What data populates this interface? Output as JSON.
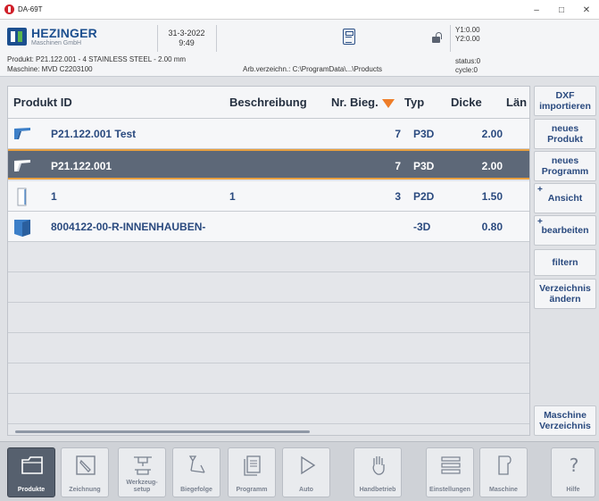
{
  "window": {
    "title": "DA-69T",
    "minimize": "–",
    "maximize": "□",
    "close": "✕"
  },
  "header": {
    "brand": "HEZINGER",
    "brand_sub": "Maschinen GmbH",
    "date": "31-3-2022",
    "time": "9:49",
    "y1": "Y1:0.00",
    "y2": "Y2:0.00",
    "product_line": "Produkt: P21.122.001 - 4 STAINLESS STEEL - 2.00 mm",
    "machine_line": "Maschine: MVD C2203100",
    "dir_line": "Arb.verzeichn.: C:\\ProgramData\\...\\Products",
    "status": "status:0",
    "cycle": "cycle:0"
  },
  "table": {
    "columns": [
      "Produkt ID",
      "Beschreibung",
      "Nr. Bieg.",
      "Typ",
      "Dicke",
      "Län"
    ],
    "sort_column": "Nr. Bieg.",
    "rows": [
      {
        "icon": "bent-profile-icon",
        "id": "P21.122.001 Test",
        "desc": "",
        "bends": "7",
        "type": "P3D",
        "thickness": "2.00",
        "selected": false
      },
      {
        "icon": "bent-profile-icon",
        "id": "P21.122.001",
        "desc": "",
        "bends": "7",
        "type": "P3D",
        "thickness": "2.00",
        "selected": true
      },
      {
        "icon": "flat-sheet-icon",
        "id": "1",
        "desc": "1",
        "bends": "3",
        "type": "P2D",
        "thickness": "1.50",
        "selected": false
      },
      {
        "icon": "box-part-icon",
        "id": "8004122-00-R-INNENHAUBEN-",
        "desc": "",
        "bends": "",
        "type": "-3D",
        "thickness": "0.80",
        "selected": false
      }
    ]
  },
  "sidebar": {
    "dxf": "DXF importieren",
    "new_product": "neues Produkt",
    "new_program": "neues Programm",
    "view": "Ansicht",
    "edit": "bearbeiten",
    "filter": "filtern",
    "change_dir": "Verzeichnis ändern",
    "machine_dir": "Maschine Verzeichnis",
    "plus": "+"
  },
  "toolbar": {
    "produkte": "Produkte",
    "zeichnung": "Zeichnung",
    "werkzeug": "Werkzeug-setup",
    "biegefolge": "Biegefolge",
    "programm": "Programm",
    "auto": "Auto",
    "handbetrieb": "Handbetrieb",
    "einstellungen": "Einstellungen",
    "maschine": "Maschine",
    "hilfe": "Hilfe"
  },
  "colors": {
    "brand_blue": "#1c4f8f",
    "accent_orange": "#ee7d28",
    "selected_row": "#5d6878",
    "text_blue": "#2a4a7f"
  }
}
